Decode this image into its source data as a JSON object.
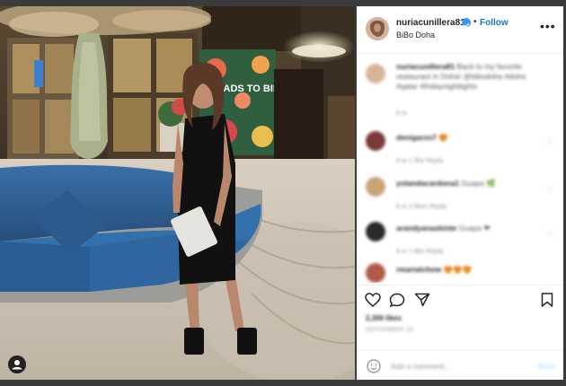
{
  "post": {
    "username": "nuriacunillera81",
    "follow_label": "Follow",
    "location": "BiBo Doha",
    "more_label": "•••",
    "mural_text": "ROADS TO BIBO"
  },
  "caption": {
    "username": "nuriacunillera81",
    "text": "Back to my favorite restaurant in Doha! @bibodoha #doha #qatar #fridaynightlights",
    "age": "8 w"
  },
  "comments": [
    {
      "username": "denigarzo7",
      "text": "😍",
      "meta": "8 w   1 like   Reply"
    },
    {
      "username": "yolandacardona1",
      "text": "Guapa 🌿",
      "meta": "8 w   3 likes   Reply"
    },
    {
      "username": "arandyanaskinte",
      "text": "Guapa ❤",
      "meta": "8 w   1 like   Reply"
    },
    {
      "username": "rmarialchow",
      "text": "😍😍😍",
      "meta": ""
    }
  ],
  "stats": {
    "likes": "2,306 likes",
    "date": "SEPTEMBER 18"
  },
  "comment_box": {
    "placeholder": "Add a comment...",
    "post_label": "Post"
  },
  "colors": {
    "follow_blue": "#1a73c8",
    "sofa_blue": "#2e5f93",
    "dress_black": "#111111",
    "floor": "#cfc6b8"
  }
}
